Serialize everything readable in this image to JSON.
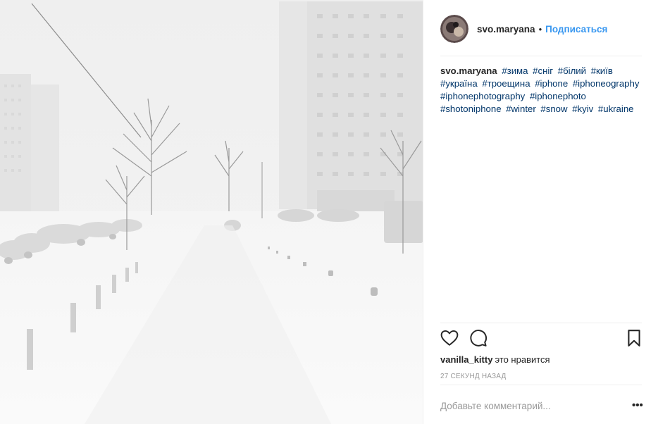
{
  "post": {
    "username": "svo.maryana",
    "separator": "•",
    "follow_label": "Подписаться",
    "caption_author": "svo.maryana",
    "hashtags": [
      "#зима",
      "#сніг",
      "#білий",
      "#київ",
      "#україна",
      "#троещина",
      "#iphone",
      "#iphoneography",
      "#iphonephotography",
      "#iphonephoto",
      "#shotoniphone",
      "#winter",
      "#snow",
      "#kyiv",
      "#ukraine"
    ]
  },
  "likes": {
    "liker": "vanilla_kitty",
    "text": "это нравится"
  },
  "timestamp": "27 секунд назад",
  "comment": {
    "placeholder": "Добавьте комментарий...",
    "more_label": "•••"
  },
  "icons": {
    "like": "heart-icon",
    "comment": "comment-icon",
    "save": "bookmark-icon",
    "options": "more-options-icon"
  },
  "colors": {
    "link_blue": "#3897f0",
    "hashtag": "#003569",
    "text": "#262626",
    "muted": "#999999",
    "divider": "#efefef"
  }
}
